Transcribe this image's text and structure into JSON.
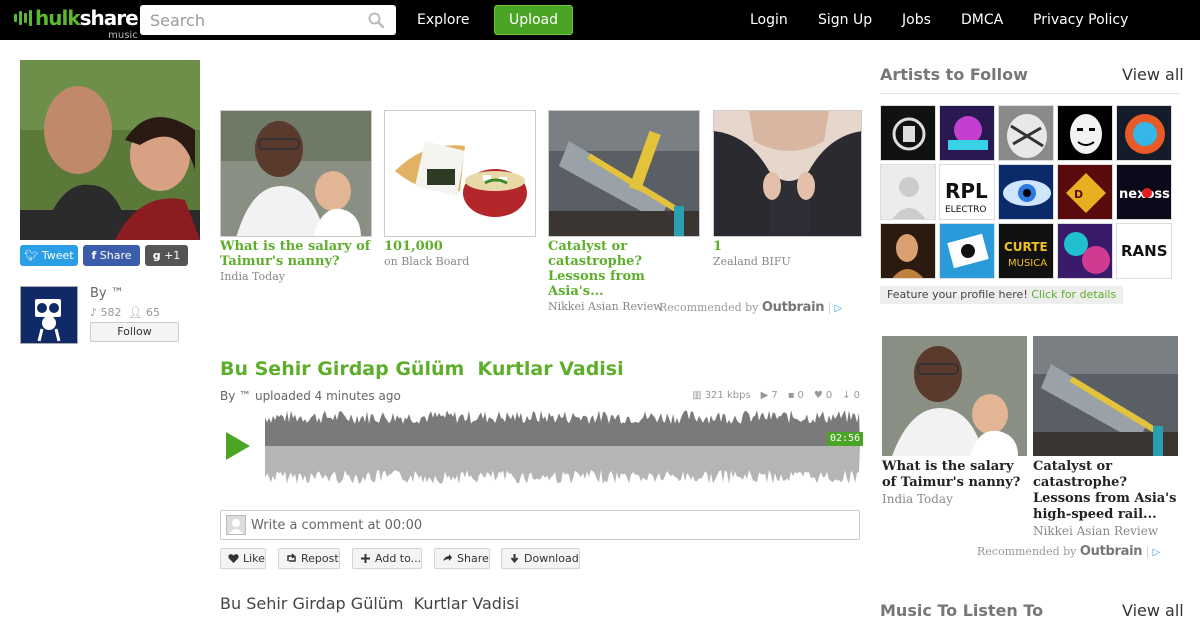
{
  "header": {
    "logo_main": "hulk",
    "logo_rest": "share",
    "logo_sub": "music",
    "search_placeholder": "Search",
    "nav": {
      "explore": "Explore",
      "upload": "Upload",
      "login": "Login",
      "signup": "Sign Up",
      "jobs": "Jobs",
      "dmca": "DMCA",
      "privacy": "Privacy Policy"
    }
  },
  "social": {
    "tweet": "Tweet",
    "share": "Share",
    "gplus": "+1"
  },
  "uploader": {
    "by": "By ™",
    "tracks": "582",
    "followers": "65",
    "follow_label": "Follow"
  },
  "outbrain_top": {
    "items": [
      {
        "title": "What is the salary of Taimur's nanny?",
        "source": "India Today"
      },
      {
        "title": "101,000",
        "source": " on Black Board"
      },
      {
        "title": "Catalyst or catastrophe? Lessons from Asia's...",
        "source": "Nikkei Asian Review"
      },
      {
        "title": "1",
        "source": "Zealand BIFU"
      }
    ],
    "recommended_by": "Recommended by",
    "brand": "Outbrain"
  },
  "track": {
    "title": "Bu Sehir Girdap Gülüm  Kurtlar Vadisi",
    "meta": "By ™ uploaded 4 minutes ago",
    "bitrate": "321 kbps",
    "plays": "7",
    "comments": "0",
    "likes": "0",
    "downloads": "0",
    "duration": "02:56",
    "comment_placeholder": "Write a comment at 00:00",
    "actions": {
      "like": "Like",
      "repost": "Repost",
      "add": "Add to...",
      "share": "Share",
      "download": "Download"
    },
    "description": "Bu Sehir Girdap Gülüm  Kurtlar Vadisi"
  },
  "sidebar": {
    "artists_title": "Artists to Follow",
    "view_all": "View all",
    "feature_text": "Feature your profile here!",
    "feature_link": "Click for details",
    "outbrain_items": [
      {
        "title": "What is the salary of Taimur's nanny?",
        "source": "India Today"
      },
      {
        "title": "Catalyst or catastrophe? Lessons from Asia's high-speed rail...",
        "source": "Nikkei Asian Review"
      }
    ],
    "recommended_by": "Recommended by",
    "brand": "Outbrain",
    "music_title": "Music To Listen To",
    "music_view_all": "View all"
  },
  "colors": {
    "brand_green": "#5cae2b",
    "topbar": "#000000",
    "upload_green": "#4aa524"
  }
}
